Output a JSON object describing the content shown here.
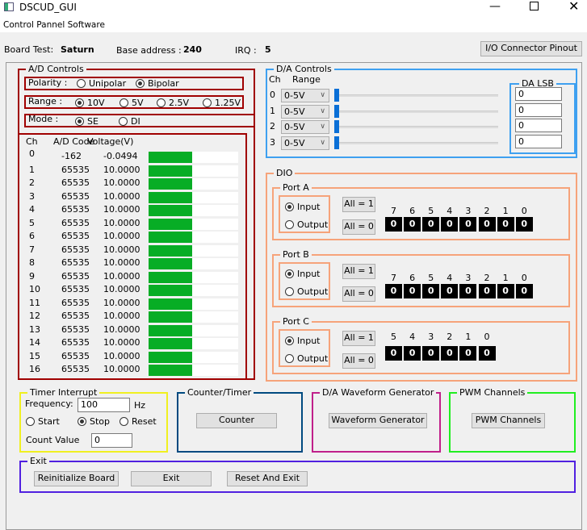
{
  "window": {
    "title": "DSCUD_GUI",
    "menu": "Control Pannel Software"
  },
  "header": {
    "board_label": "Board Test:",
    "board_value": "Saturn",
    "base_label": "Base address :",
    "base_value": "240",
    "irq_label": "IRQ :",
    "irq_value": "5",
    "pinout_button": "I/O Connector Pinout"
  },
  "ad": {
    "title": "A/D Controls",
    "polarity": {
      "label": "Polarity  :",
      "options": [
        "Unipolar",
        "Bipolar"
      ],
      "selected": "Bipolar"
    },
    "range": {
      "label": "Range   :",
      "options": [
        "10V",
        "5V",
        "2.5V",
        "1.25V"
      ],
      "selected": "10V"
    },
    "mode": {
      "label": "Mode   :",
      "options": [
        "SE",
        "DI"
      ],
      "selected": "SE"
    },
    "headers": [
      "Ch",
      "A/D Code",
      "Voltage(V)"
    ],
    "rows": [
      {
        "ch": "0",
        "code": "-162",
        "volt": "-0.0494",
        "level": 0.49
      },
      {
        "ch": "1",
        "code": "65535",
        "volt": "10.0000",
        "level": 0.49
      },
      {
        "ch": "2",
        "code": "65535",
        "volt": "10.0000",
        "level": 0.49
      },
      {
        "ch": "3",
        "code": "65535",
        "volt": "10.0000",
        "level": 0.49
      },
      {
        "ch": "4",
        "code": "65535",
        "volt": "10.0000",
        "level": 0.49
      },
      {
        "ch": "5",
        "code": "65535",
        "volt": "10.0000",
        "level": 0.49
      },
      {
        "ch": "6",
        "code": "65535",
        "volt": "10.0000",
        "level": 0.49
      },
      {
        "ch": "7",
        "code": "65535",
        "volt": "10.0000",
        "level": 0.49
      },
      {
        "ch": "8",
        "code": "65535",
        "volt": "10.0000",
        "level": 0.49
      },
      {
        "ch": "9",
        "code": "65535",
        "volt": "10.0000",
        "level": 0.49
      },
      {
        "ch": "10",
        "code": "65535",
        "volt": "10.0000",
        "level": 0.49
      },
      {
        "ch": "11",
        "code": "65535",
        "volt": "10.0000",
        "level": 0.49
      },
      {
        "ch": "12",
        "code": "65535",
        "volt": "10.0000",
        "level": 0.49
      },
      {
        "ch": "13",
        "code": "65535",
        "volt": "10.0000",
        "level": 0.49
      },
      {
        "ch": "14",
        "code": "65535",
        "volt": "10.0000",
        "level": 0.49
      },
      {
        "ch": "15",
        "code": "65535",
        "volt": "10.0000",
        "level": 0.49
      },
      {
        "ch": "16",
        "code": "65535",
        "volt": "10.0000",
        "level": 0.49
      }
    ]
  },
  "da": {
    "title": "D/A Controls",
    "ch_header": "Ch",
    "range_header": "Range",
    "lsb_title": "DA LSB",
    "channels": [
      {
        "ch": "0",
        "range": "0-5V",
        "lsb": "0",
        "slider": 0
      },
      {
        "ch": "1",
        "range": "0-5V",
        "lsb": "0",
        "slider": 0
      },
      {
        "ch": "2",
        "range": "0-5V",
        "lsb": "0",
        "slider": 0
      },
      {
        "ch": "3",
        "range": "0-5V",
        "lsb": "0",
        "slider": 0
      }
    ]
  },
  "dio": {
    "title": "DIO",
    "input_label": "Input",
    "output_label": "Output",
    "all1": "All = 1",
    "all0": "All = 0",
    "ports": [
      {
        "name": "Port A",
        "mode": "Input",
        "bits": [
          "7",
          "6",
          "5",
          "4",
          "3",
          "2",
          "1",
          "0"
        ],
        "values": [
          "0",
          "0",
          "0",
          "0",
          "0",
          "0",
          "0",
          "0"
        ]
      },
      {
        "name": "Port B",
        "mode": "Input",
        "bits": [
          "7",
          "6",
          "5",
          "4",
          "3",
          "2",
          "1",
          "0"
        ],
        "values": [
          "0",
          "0",
          "0",
          "0",
          "0",
          "0",
          "0",
          "0"
        ]
      },
      {
        "name": "Port C",
        "mode": "Input",
        "bits": [
          "5",
          "4",
          "3",
          "2",
          "1",
          "0"
        ],
        "values": [
          "0",
          "0",
          "0",
          "0",
          "0",
          "0"
        ]
      }
    ]
  },
  "timer": {
    "title": "Timer Interrupt",
    "freq_label": "Frequency:",
    "freq_value": "100",
    "freq_unit": "Hz",
    "options": [
      "Start",
      "Stop",
      "Reset"
    ],
    "selected": "Stop",
    "count_label": "Count Value",
    "count_value": "0"
  },
  "counter": {
    "title": "Counter/Timer",
    "button": "Counter"
  },
  "waveform": {
    "title": "D/A Waveform Generator",
    "button": "Waveform Generator"
  },
  "pwm": {
    "title": "PWM Channels",
    "button": "PWM Channels"
  },
  "exit": {
    "title": "Exit",
    "buttons": [
      "Reinitialize Board",
      "Exit",
      "Reset And Exit"
    ]
  },
  "colors": {
    "ad": "#a00000",
    "da": "#3ea0f0",
    "dio": "#f6a37a",
    "timer": "#f0f020",
    "counter": "#004a80",
    "waveform": "#c0208a",
    "pwm": "#20ee20",
    "exit": "#5020e0",
    "bar": "#07ad25"
  }
}
